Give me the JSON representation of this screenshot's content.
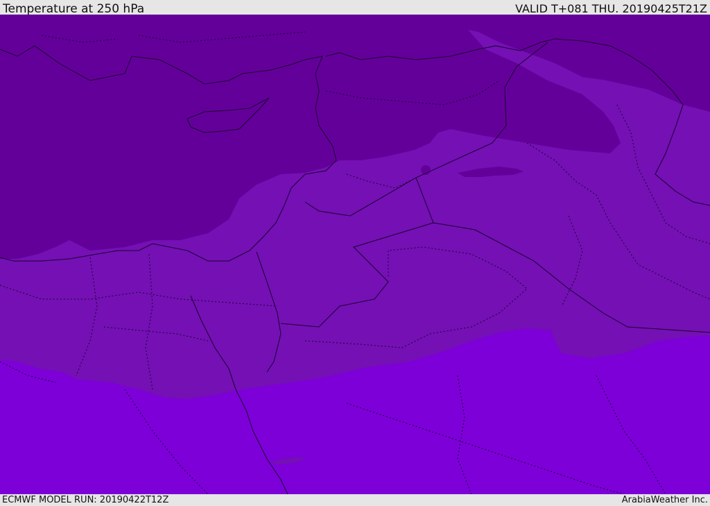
{
  "header": {
    "title": "Temperature at 250 hPa",
    "valid": "VALID T+081 THU. 20190425T21Z"
  },
  "footer": {
    "model_run": "ECMWF MODEL RUN: 20190422T12Z",
    "credit": "ArabiaWeather Inc."
  },
  "map": {
    "colors": {
      "coldest_band": "#64009a",
      "cold_band": "#7410b4",
      "warm_band": "#7d00d8",
      "border_line": "#1a0030"
    }
  }
}
